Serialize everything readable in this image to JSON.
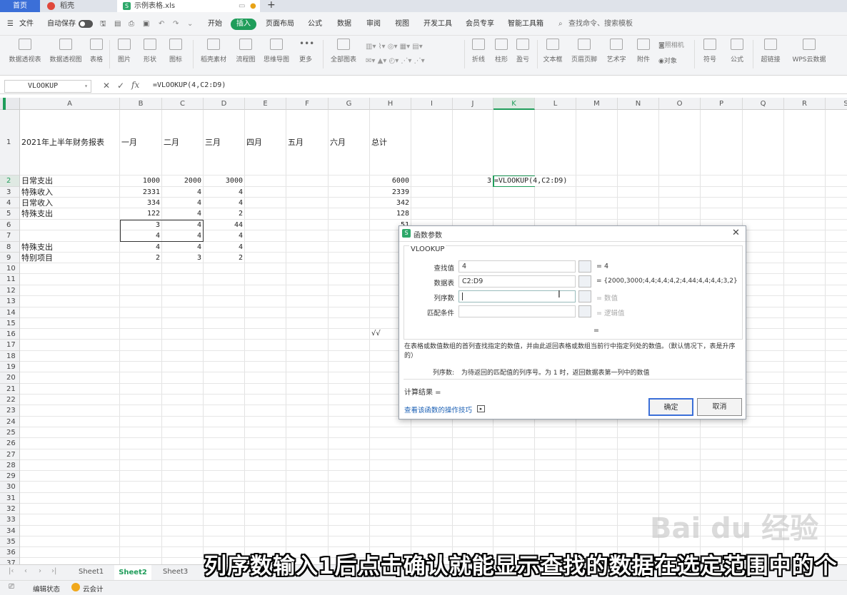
{
  "tabs": {
    "home": "首页",
    "daoke": "稻壳",
    "file": "示例表格.xls",
    "new_tab": "+"
  },
  "menus": {
    "file": "文件",
    "autosave": "自动保存",
    "items": [
      "开始",
      "插入",
      "页面布局",
      "公式",
      "数据",
      "审阅",
      "视图",
      "开发工具",
      "会员专享",
      "智能工具箱"
    ],
    "search": "查找命令、搜索模板"
  },
  "ribbon": [
    "数据透视表",
    "数据透视图",
    "表格",
    "图片",
    "形状",
    "图标",
    "稻壳素材",
    "流程图",
    "思维导图",
    "更多",
    "全部图表",
    "折线",
    "柱形",
    "盈亏",
    "文本框",
    "页眉页脚",
    "艺术字",
    "附件",
    "对象",
    "符号",
    "公式",
    "超链接",
    "WPS云数据"
  ],
  "ribbon_small": {
    "camera": "照相机"
  },
  "formula_bar": {
    "name_box": "VLOOKUP",
    "formula": "=VLOOKUP(4,C2:D9)"
  },
  "columns": [
    "A",
    "B",
    "C",
    "D",
    "E",
    "F",
    "G",
    "H",
    "I",
    "J",
    "K",
    "L",
    "M",
    "N",
    "O",
    "P",
    "Q",
    "R",
    "S"
  ],
  "rows": [
    "1",
    "2",
    "3",
    "4",
    "5",
    "6",
    "7",
    "8",
    "9",
    "10",
    "11",
    "12",
    "13",
    "14",
    "15",
    "16",
    "17",
    "18",
    "19",
    "20",
    "21",
    "22",
    "23",
    "24",
    "25",
    "26",
    "27",
    "28",
    "29",
    "30",
    "31",
    "32",
    "33",
    "34",
    "35",
    "36",
    "37"
  ],
  "sheet": {
    "header": {
      "A": "2021年上半年财务报表",
      "B": "一月",
      "C": "二月",
      "D": "三月",
      "E": "四月",
      "F": "五月",
      "G": "六月",
      "H": "总计"
    },
    "data_rows": [
      {
        "A": "日常支出",
        "B": "1000",
        "C": "2000",
        "D": "3000",
        "H": "6000"
      },
      {
        "A": "特殊收入",
        "B": "2331",
        "C": "4",
        "D": "4",
        "H": "2339"
      },
      {
        "A": "日常收入",
        "B": "334",
        "C": "4",
        "D": "4",
        "H": "342"
      },
      {
        "A": "特殊支出",
        "B": "122",
        "C": "4",
        "D": "2",
        "H": "128"
      },
      {
        "A": "",
        "B": "3",
        "C": "4",
        "D": "44",
        "H": "51"
      },
      {
        "A": "",
        "B": "4",
        "C": "4",
        "D": "4",
        "H": ""
      },
      {
        "A": "特殊支出",
        "B": "4",
        "C": "4",
        "D": "4",
        "H": ""
      },
      {
        "A": "特别项目",
        "B": "2",
        "C": "3",
        "D": "2",
        "H": ""
      }
    ],
    "J2": "3",
    "K2": "=VLOOKUP(4,C2:D9)",
    "H16": "√√"
  },
  "dialog": {
    "title": "函数参数",
    "func": "VLOOKUP",
    "args": [
      {
        "label": "查找值",
        "value": "4",
        "result": "= 4"
      },
      {
        "label": "数据表",
        "value": "C2:D9",
        "result": "= {2000,3000;4,4;4,4;4,2;4,44;4,4;4,4;3,2}"
      },
      {
        "label": "列序数",
        "value": "",
        "result": "= 数值"
      },
      {
        "label": "匹配条件",
        "value": "",
        "result": "= 逻辑值"
      }
    ],
    "eq": "=",
    "description": "在表格或数值数组的首列查找指定的数值，并由此返回表格或数组当前行中指定列处的数值。（默认情况下，表是升序的）",
    "arg_help_label": "列序数:",
    "arg_help": "为待返回的匹配值的列序号。为 1 时，返回数据表第一列中的数值",
    "result_label": "计算结果 =",
    "help_link": "查看该函数的操作技巧",
    "ok": "确定",
    "cancel": "取消"
  },
  "sheet_tabs": [
    "Sheet1",
    "Sheet2",
    "Sheet3"
  ],
  "active_sheet": "Sheet2",
  "status": {
    "edit": "编辑状态",
    "cloud": "云会计"
  },
  "caption": "列序数输入1后点击确认就能显示查找的数据在选定范围中的个",
  "watermark": "Bai du 经验",
  "colors": {
    "accent": "#1f9d5a",
    "home_tab": "#3b6fd8",
    "link": "#1a5fb4"
  }
}
